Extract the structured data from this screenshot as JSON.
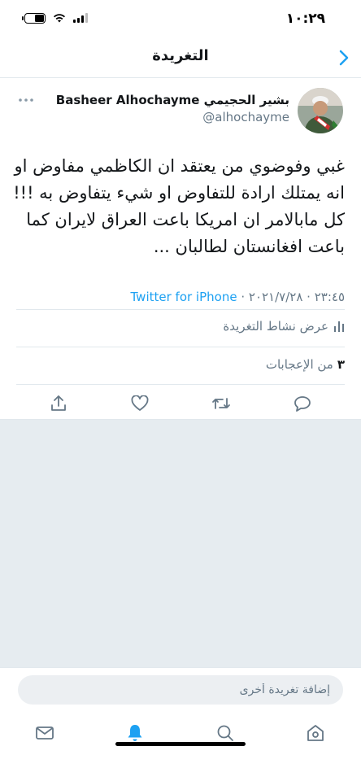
{
  "status_bar": {
    "time": "١٠:٢٩",
    "battery_level": 0.5
  },
  "header": {
    "title": "التغريدة"
  },
  "tweet": {
    "author_name": "بشير الحجيمي Basheer Alhochayme",
    "author_handle": "@alhochayme",
    "text": "غبي وفوضوي من يعتقد ان الكاظمي مفاوض او انه يمتلك ارادة للتفاوض او  شيء يتفاوض به !!! كل مابالامر ان امريكا باعت العراق لايران كما باعت افغانستان لطالبان ...",
    "date": "٢٠٢١/٧/٢٨",
    "time": "٢٣:٤٥",
    "separator": " · ",
    "source": "Twitter for iPhone",
    "activity_label": "عرض نشاط التغريدة",
    "likes_count": "٣",
    "likes_label": "من الإعجابات"
  },
  "compose": {
    "placeholder": "إضافة تغريدة أخرى"
  },
  "colors": {
    "accent": "#1da1f2",
    "secondary_text": "#657786",
    "divider": "#e1e8ed",
    "feed_background": "#e6ecf0"
  },
  "icons": {
    "back": "chevron-right-icon",
    "more": "more-horizontal-icon",
    "reply": "comment-icon",
    "retweet": "retweet-icon",
    "like": "heart-icon",
    "share": "share-icon",
    "activity": "bar-chart-icon",
    "tab_home": "home-icon",
    "tab_search": "search-icon",
    "tab_notifications": "bell-icon",
    "tab_messages": "mail-icon"
  }
}
